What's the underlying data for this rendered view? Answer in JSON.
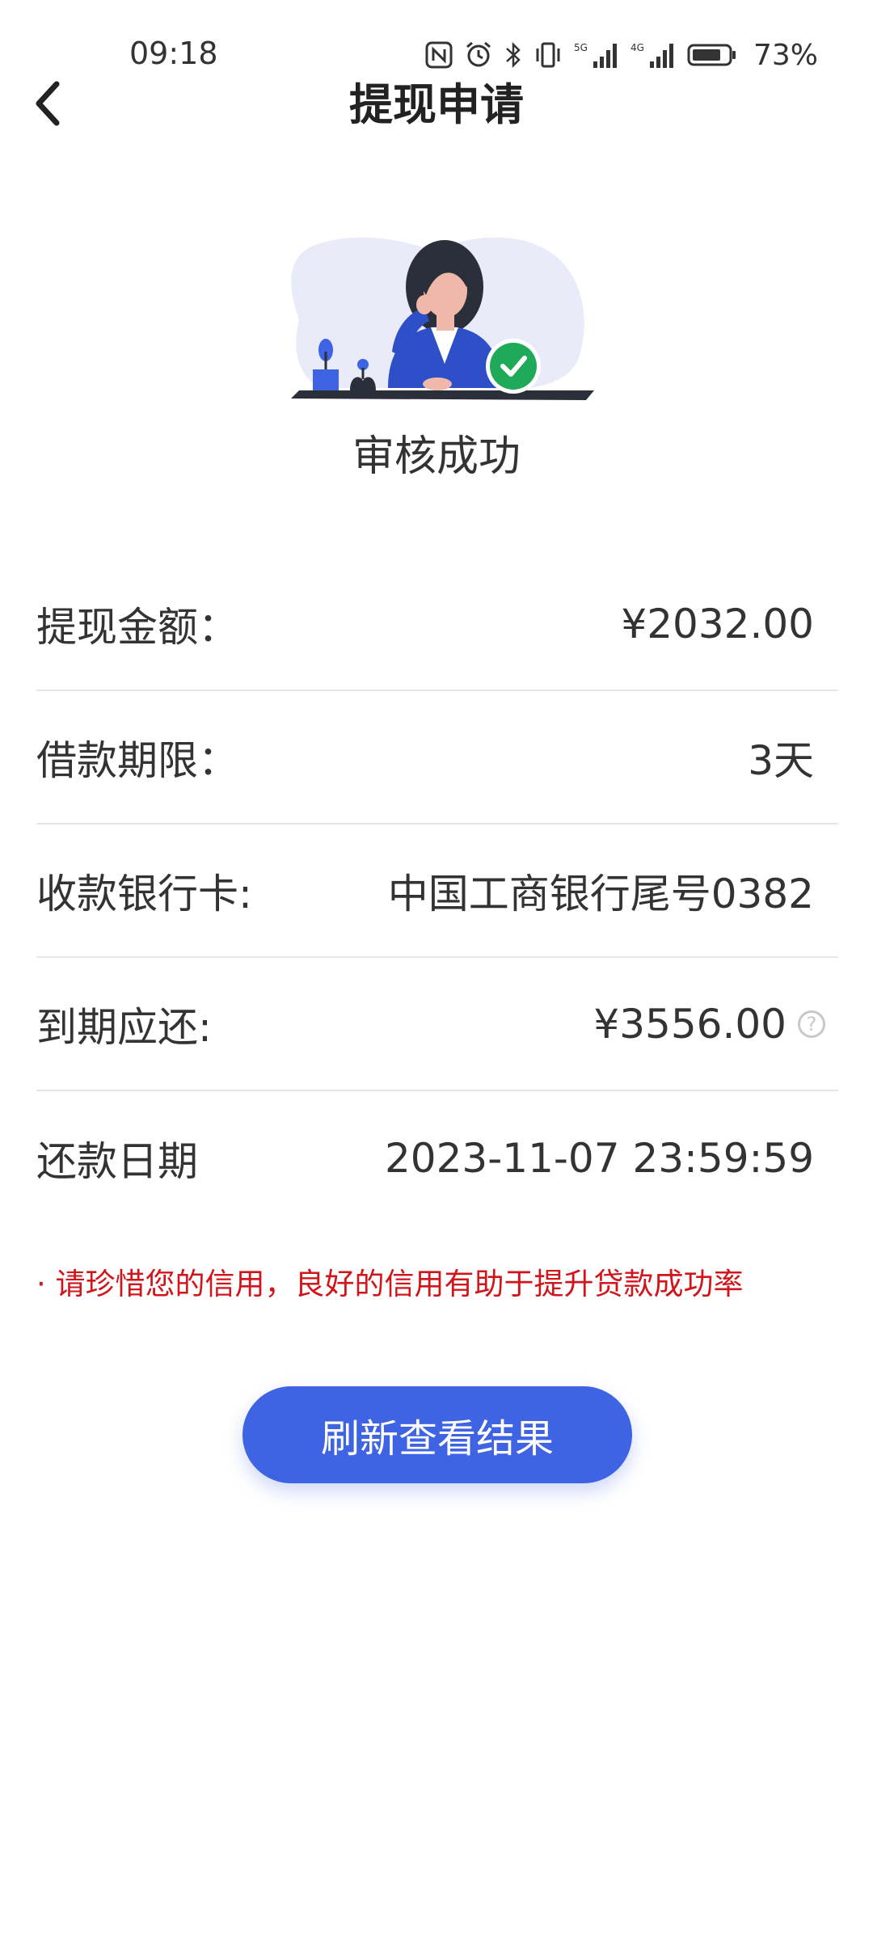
{
  "status_bar": {
    "time": "09:18",
    "icons": [
      "nfc-icon",
      "alarm-icon",
      "bluetooth-icon",
      "vibrate-icon",
      "5g-signal-icon",
      "4g-signal-icon",
      "battery-icon"
    ],
    "battery_percent": "73%"
  },
  "header": {
    "title": "提现申请",
    "back_icon": "chevron-left-icon"
  },
  "result": {
    "illustration": "woman-at-desk-with-check",
    "status_text": "审核成功",
    "check_color": "#1faa5a"
  },
  "details": [
    {
      "label": "提现金额：",
      "value": "¥2032.00"
    },
    {
      "label": "借款期限：",
      "value": "3天"
    },
    {
      "label": "收款银行卡:",
      "value": "中国工商银行尾号0382"
    },
    {
      "label": "到期应还:",
      "value": "¥3556.00",
      "help_icon": "question-circle-icon"
    },
    {
      "label": "还款日期",
      "value": "2023-11-07 23:59:59"
    }
  ],
  "notice": "· 请珍惜您的信用，良好的信用有助于提升贷款成功率",
  "refresh_button": "刷新查看结果",
  "colors": {
    "accent": "#3e63e3",
    "notice": "#d0161b",
    "success": "#1faa5a"
  }
}
